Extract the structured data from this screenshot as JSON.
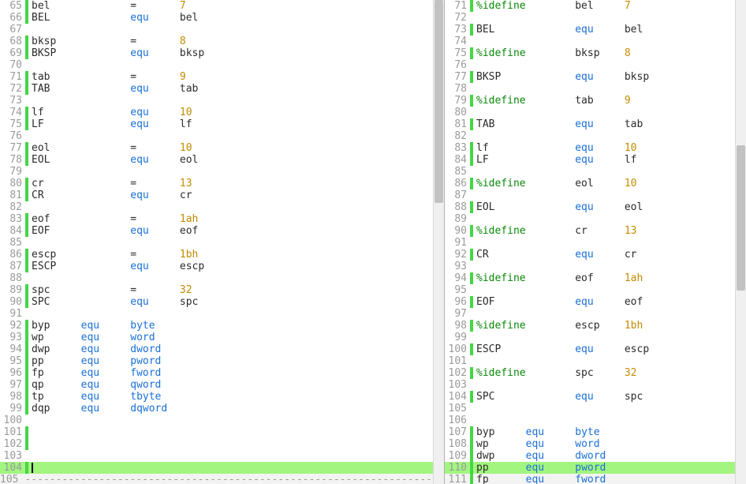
{
  "colors": {
    "highlight": "#a2f57f",
    "marker": "#45d645",
    "keyword": "#0a8a0a",
    "equ": "#1a6fd6",
    "number": "#c28b00"
  },
  "chart_data": null,
  "left_pane": {
    "scrollbar": {
      "thumb_top_pct": 0,
      "thumb_height_pct": 42
    },
    "lines": [
      {
        "n": 65,
        "mark": "g",
        "cols": [
          "bel",
          "",
          "=",
          "",
          "7"
        ]
      },
      {
        "n": 66,
        "mark": "g",
        "cols": [
          "BEL",
          "",
          "equ",
          "",
          "bel"
        ]
      },
      {
        "n": 67,
        "mark": "",
        "cols": [
          ""
        ]
      },
      {
        "n": 68,
        "mark": "g",
        "cols": [
          "bksp",
          "",
          "=",
          "",
          "8"
        ]
      },
      {
        "n": 69,
        "mark": "g",
        "cols": [
          "BKSP",
          "",
          "equ",
          "",
          "bksp"
        ]
      },
      {
        "n": 70,
        "mark": "",
        "cols": [
          ""
        ]
      },
      {
        "n": 71,
        "mark": "g",
        "cols": [
          "tab",
          "",
          "=",
          "",
          "9"
        ]
      },
      {
        "n": 72,
        "mark": "g",
        "cols": [
          "TAB",
          "",
          "equ",
          "",
          "tab"
        ]
      },
      {
        "n": 73,
        "mark": "",
        "cols": [
          ""
        ]
      },
      {
        "n": 74,
        "mark": "g",
        "cols": [
          "lf",
          "",
          "equ",
          "",
          "10"
        ]
      },
      {
        "n": 75,
        "mark": "g",
        "cols": [
          "LF",
          "",
          "equ",
          "",
          "lf"
        ]
      },
      {
        "n": 76,
        "mark": "",
        "cols": [
          ""
        ]
      },
      {
        "n": 77,
        "mark": "g",
        "cols": [
          "eol",
          "",
          "=",
          "",
          "10"
        ]
      },
      {
        "n": 78,
        "mark": "g",
        "cols": [
          "EOL",
          "",
          "equ",
          "",
          "eol"
        ]
      },
      {
        "n": 79,
        "mark": "",
        "cols": [
          ""
        ]
      },
      {
        "n": 80,
        "mark": "g",
        "cols": [
          "cr",
          "",
          "=",
          "",
          "13"
        ]
      },
      {
        "n": 81,
        "mark": "g",
        "cols": [
          "CR",
          "",
          "equ",
          "",
          "cr"
        ]
      },
      {
        "n": 82,
        "mark": "",
        "cols": [
          ""
        ]
      },
      {
        "n": 83,
        "mark": "g",
        "cols": [
          "eof",
          "",
          "=",
          "",
          "1ah"
        ]
      },
      {
        "n": 84,
        "mark": "g",
        "cols": [
          "EOF",
          "",
          "equ",
          "",
          "eof"
        ]
      },
      {
        "n": 85,
        "mark": "",
        "cols": [
          ""
        ]
      },
      {
        "n": 86,
        "mark": "g",
        "cols": [
          "escp",
          "",
          "=",
          "",
          "1bh"
        ]
      },
      {
        "n": 87,
        "mark": "g",
        "cols": [
          "ESCP",
          "",
          "equ",
          "",
          "escp"
        ]
      },
      {
        "n": 88,
        "mark": "",
        "cols": [
          ""
        ]
      },
      {
        "n": 89,
        "mark": "g",
        "cols": [
          "spc",
          "",
          "=",
          "",
          "32"
        ]
      },
      {
        "n": 90,
        "mark": "g",
        "cols": [
          "SPC",
          "",
          "equ",
          "",
          "spc"
        ]
      },
      {
        "n": 91,
        "mark": "",
        "cols": [
          ""
        ]
      },
      {
        "n": 92,
        "mark": "g",
        "cols": [
          "byp",
          "equ",
          "byte"
        ]
      },
      {
        "n": 93,
        "mark": "g",
        "cols": [
          "wp",
          "equ",
          "word"
        ]
      },
      {
        "n": 94,
        "mark": "g",
        "cols": [
          "dwp",
          "equ",
          "dword"
        ]
      },
      {
        "n": 95,
        "mark": "g",
        "cols": [
          "pp",
          "equ",
          "pword"
        ]
      },
      {
        "n": 96,
        "mark": "g",
        "cols": [
          "fp",
          "equ",
          "fword"
        ]
      },
      {
        "n": 97,
        "mark": "g",
        "cols": [
          "qp",
          "equ",
          "qword"
        ]
      },
      {
        "n": 98,
        "mark": "g",
        "cols": [
          "tp",
          "equ",
          "tbyte"
        ]
      },
      {
        "n": 99,
        "mark": "g",
        "cols": [
          "dqp",
          "equ",
          "dqword"
        ]
      },
      {
        "n": 100,
        "mark": "",
        "cols": [
          ""
        ]
      },
      {
        "n": 101,
        "mark": "g",
        "cols": [
          ""
        ]
      },
      {
        "n": 102,
        "mark": "g",
        "cols": [
          ""
        ]
      },
      {
        "n": 103,
        "mark": "",
        "cols": [
          ""
        ]
      },
      {
        "n": 104,
        "mark": "g",
        "hl": true,
        "cursor": true,
        "cols": [
          ""
        ]
      },
      {
        "n": 105,
        "mark": "",
        "dim": true,
        "dashes": true,
        "cols": [
          ""
        ]
      }
    ]
  },
  "right_pane": {
    "scrollbar": {
      "thumb_top_pct": 30,
      "thumb_height_pct": 30
    },
    "lines": [
      {
        "n": 71,
        "mark": "g",
        "cols": [
          "%idefine",
          "",
          "bel",
          "",
          "7"
        ]
      },
      {
        "n": 72,
        "mark": "",
        "cols": [
          ""
        ]
      },
      {
        "n": 73,
        "mark": "g",
        "cols": [
          "BEL",
          "",
          "equ",
          "",
          "bel"
        ]
      },
      {
        "n": 74,
        "mark": "",
        "cols": [
          ""
        ]
      },
      {
        "n": 75,
        "mark": "g",
        "cols": [
          "%idefine",
          "",
          "bksp",
          "",
          "8"
        ]
      },
      {
        "n": 76,
        "mark": "",
        "cols": [
          ""
        ]
      },
      {
        "n": 77,
        "mark": "g",
        "cols": [
          "BKSP",
          "",
          "equ",
          "",
          "bksp"
        ]
      },
      {
        "n": 78,
        "mark": "",
        "cols": [
          ""
        ]
      },
      {
        "n": 79,
        "mark": "g",
        "cols": [
          "%idefine",
          "",
          "tab",
          "",
          "9"
        ]
      },
      {
        "n": 80,
        "mark": "",
        "cols": [
          ""
        ]
      },
      {
        "n": 81,
        "mark": "g",
        "cols": [
          "TAB",
          "",
          "equ",
          "",
          "tab"
        ]
      },
      {
        "n": 82,
        "mark": "",
        "cols": [
          ""
        ]
      },
      {
        "n": 83,
        "mark": "g",
        "cols": [
          "lf",
          "",
          "equ",
          "",
          "10"
        ]
      },
      {
        "n": 84,
        "mark": "g",
        "cols": [
          "LF",
          "",
          "equ",
          "",
          "lf"
        ]
      },
      {
        "n": 85,
        "mark": "",
        "cols": [
          ""
        ]
      },
      {
        "n": 86,
        "mark": "g",
        "cols": [
          "%idefine",
          "",
          "eol",
          "",
          "10"
        ]
      },
      {
        "n": 87,
        "mark": "",
        "cols": [
          ""
        ]
      },
      {
        "n": 88,
        "mark": "g",
        "cols": [
          "EOL",
          "",
          "equ",
          "",
          "eol"
        ]
      },
      {
        "n": 89,
        "mark": "",
        "cols": [
          ""
        ]
      },
      {
        "n": 90,
        "mark": "g",
        "cols": [
          "%idefine",
          "",
          "cr",
          "",
          "13"
        ]
      },
      {
        "n": 91,
        "mark": "",
        "cols": [
          ""
        ]
      },
      {
        "n": 92,
        "mark": "g",
        "cols": [
          "CR",
          "",
          "equ",
          "",
          "cr"
        ]
      },
      {
        "n": 93,
        "mark": "",
        "cols": [
          ""
        ]
      },
      {
        "n": 94,
        "mark": "g",
        "cols": [
          "%idefine",
          "",
          "eof",
          "",
          "1ah"
        ]
      },
      {
        "n": 95,
        "mark": "",
        "cols": [
          ""
        ]
      },
      {
        "n": 96,
        "mark": "g",
        "cols": [
          "EOF",
          "",
          "equ",
          "",
          "eof"
        ]
      },
      {
        "n": 97,
        "mark": "",
        "cols": [
          ""
        ]
      },
      {
        "n": 98,
        "mark": "g",
        "cols": [
          "%idefine",
          "",
          "escp",
          "",
          "1bh"
        ]
      },
      {
        "n": 99,
        "mark": "",
        "cols": [
          ""
        ]
      },
      {
        "n": 100,
        "mark": "g",
        "cols": [
          "ESCP",
          "",
          "equ",
          "",
          "escp"
        ]
      },
      {
        "n": 101,
        "mark": "",
        "cols": [
          ""
        ]
      },
      {
        "n": 102,
        "mark": "g",
        "cols": [
          "%idefine",
          "",
          "spc",
          "",
          "32"
        ]
      },
      {
        "n": 103,
        "mark": "",
        "cols": [
          ""
        ]
      },
      {
        "n": 104,
        "mark": "g",
        "cols": [
          "SPC",
          "",
          "equ",
          "",
          "spc"
        ]
      },
      {
        "n": 105,
        "mark": "",
        "cols": [
          ""
        ]
      },
      {
        "n": 106,
        "mark": "",
        "cols": [
          ""
        ]
      },
      {
        "n": 107,
        "mark": "g",
        "cols": [
          "byp",
          "equ",
          "byte"
        ]
      },
      {
        "n": 108,
        "mark": "g",
        "cols": [
          "wp",
          "equ",
          "word"
        ]
      },
      {
        "n": 109,
        "mark": "g",
        "cols": [
          "dwp",
          "equ",
          "dword"
        ]
      },
      {
        "n": 110,
        "mark": "g",
        "hl": true,
        "cols": [
          "pp",
          "equ",
          "pword"
        ]
      },
      {
        "n": 111,
        "mark": "g",
        "dim": true,
        "cols": [
          "fp",
          "equ",
          "fword"
        ]
      }
    ]
  }
}
